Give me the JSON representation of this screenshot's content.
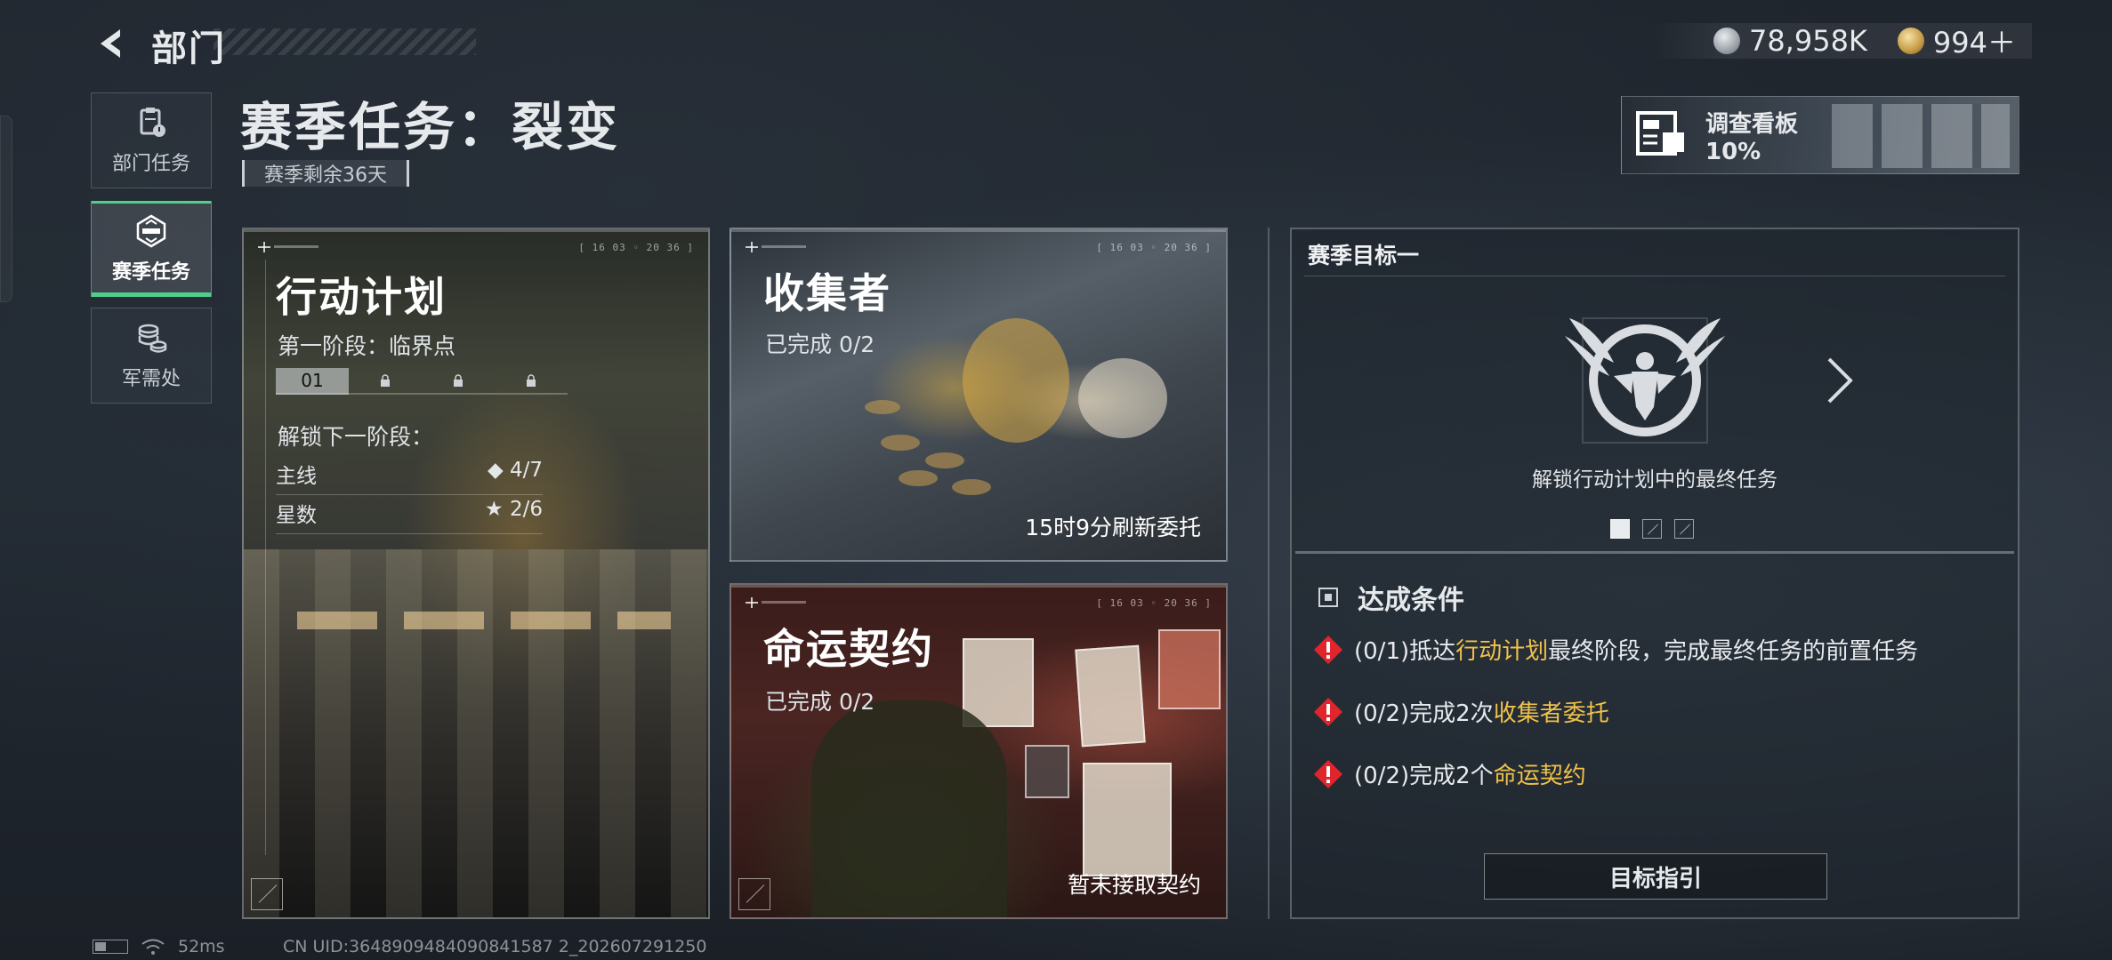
{
  "header": {
    "title": "部门",
    "currency": [
      {
        "icon": "silver-coin-icon",
        "value": "78,958K"
      },
      {
        "icon": "gold-coin-icon",
        "value": "994＋"
      }
    ]
  },
  "sidebar": {
    "items": [
      {
        "label": "部门任务",
        "icon": "clipboard-icon",
        "active": false
      },
      {
        "label": "赛季任务",
        "icon": "season-badge-icon",
        "active": true
      },
      {
        "label": "军需处",
        "icon": "coins-stack-icon",
        "active": false
      }
    ]
  },
  "page": {
    "title": "赛季任务：裂变",
    "remaining": "赛季剩余36天"
  },
  "board": {
    "label": "调查看板",
    "progress": "10%"
  },
  "cards": {
    "plan": {
      "title": "行动计划",
      "stage_text": "第一阶段：临界点",
      "stages": [
        "01",
        "lock",
        "lock",
        "lock"
      ],
      "unlock_label": "解锁下一阶段：",
      "rows": [
        {
          "label": "主线",
          "icon": "diamond-icon",
          "symbol": "◆",
          "value": "4/7"
        },
        {
          "label": "星数",
          "icon": "star-icon",
          "symbol": "★",
          "value": "2/6"
        }
      ],
      "corner": "[ 16 03 ◦ 20 36 ]"
    },
    "collector": {
      "title": "收集者",
      "progress": "已完成 0/2",
      "footer": "15时9分刷新委托",
      "corner": "[ 16 03 ◦ 20 36 ]"
    },
    "fate": {
      "title": "命运契约",
      "progress": "已完成 0/2",
      "footer": "暂未接取契约",
      "corner": "[ 16 03 ◦ 20 36 ]"
    }
  },
  "goal": {
    "header": "赛季目标一",
    "caption": "解锁行动计划中的最终任务",
    "conditions_title": "达成条件",
    "conditions": [
      {
        "pre": "(0/1)抵达",
        "hl": "行动计划",
        "post": "最终阶段，完成最终任务的前置任务"
      },
      {
        "pre": "(0/2)完成2次",
        "hl": "收集者委托",
        "post": ""
      },
      {
        "pre": "(0/2)完成2个",
        "hl": "命运契约",
        "post": ""
      }
    ],
    "guide_button": "目标指引"
  },
  "status": {
    "ping": "52ms",
    "uid": "CN UID:3648909484090841587 2_202607291250"
  },
  "colors": {
    "accent_green": "#4fd08a",
    "highlight_yellow": "#f0c24a",
    "warning_red": "#e0262c"
  }
}
